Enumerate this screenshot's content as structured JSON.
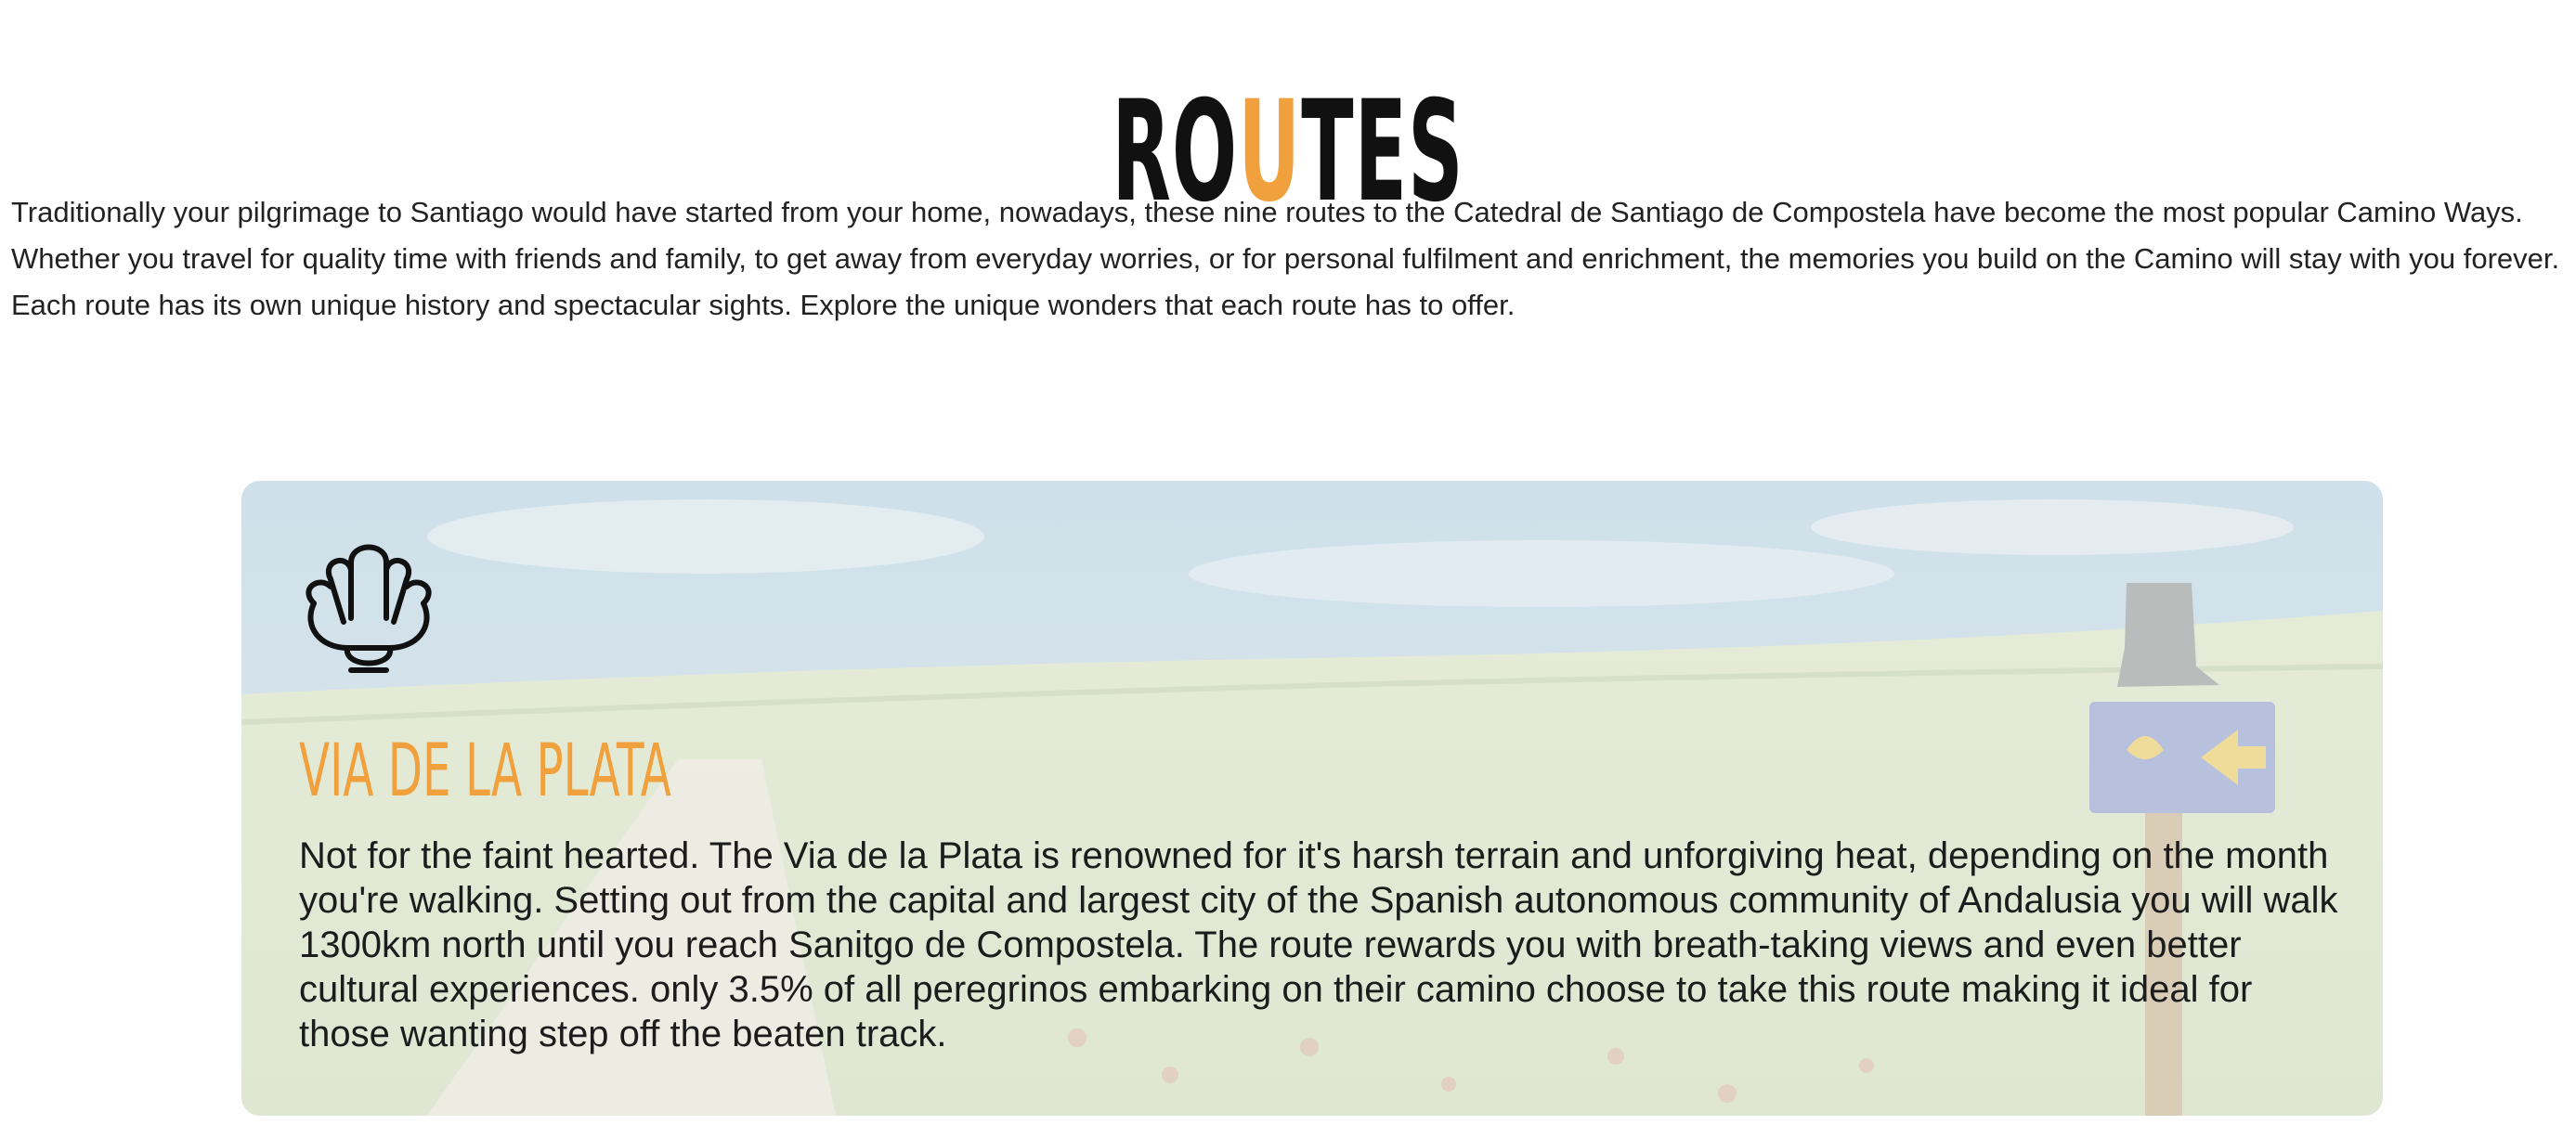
{
  "colors": {
    "accent": "#f0a03c",
    "text": "#1a1a1a"
  },
  "page": {
    "title_prefix": "RO",
    "title_accent": "U",
    "title_suffix": "TES",
    "intro": "Traditionally your pilgrimage to Santiago would have started from your home, nowadays, these nine routes to the Catedral de Santiago de Compostela have become the most popular Camino Ways. Whether you travel for quality time with friends and family, to get away from everyday worries, or for personal fulfilment and enrichment, the memories you build on the Camino will stay with you forever. Each route has its own unique history and spectacular sights. Explore the unique wonders that each route has to offer."
  },
  "route": {
    "icon": "scallop-shell-icon",
    "title": "VIA DE LA PLATA",
    "description": "Not for the faint hearted. The Via de la Plata is renowned for it's harsh terrain and unforgiving heat, depending on the month you're walking. Setting out from the capital and largest city of the Spanish autonomous community of Andalusia you will walk 1300km north until you reach Sanitgo de Compostela. The route rewards you with breath-taking views and even better cultural experiences. only 3.5% of all peregrinos embarking on their camino choose to take this route making it ideal for those wanting step off the beaten track."
  }
}
